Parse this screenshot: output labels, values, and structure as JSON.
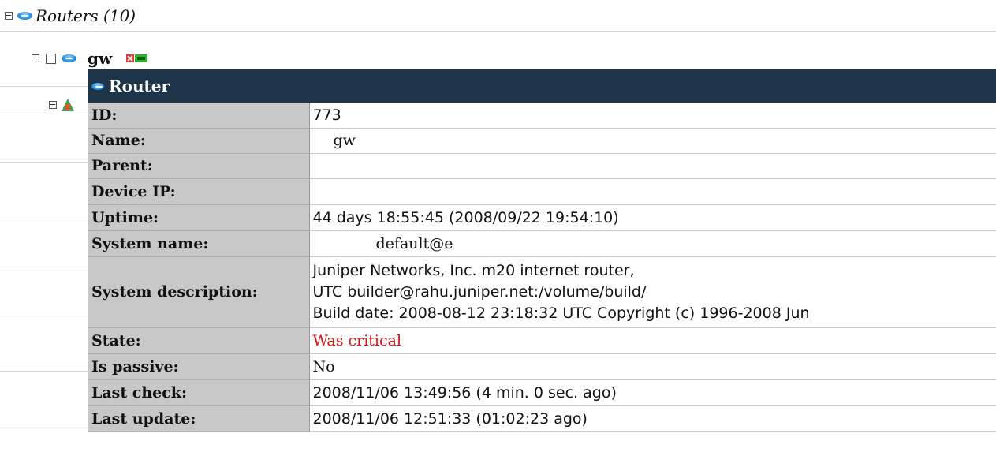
{
  "tree": {
    "root_label": "Routers (10)",
    "node_label": "gw"
  },
  "popup": {
    "title": "Router",
    "rows": [
      {
        "key": "ID:",
        "value": "773"
      },
      {
        "key": "Name:",
        "value": "gw"
      },
      {
        "key": "Parent:",
        "value": ""
      },
      {
        "key": "Device IP:",
        "value": ""
      },
      {
        "key": "Uptime:",
        "value": "44 days 18:55:45 (2008/09/22 19:54:10)"
      },
      {
        "key": "System name:",
        "value": "default@e"
      },
      {
        "key": "System description:",
        "lines": [
          "Juniper Networks, Inc. m20 internet router,",
          "UTC builder@rahu.juniper.net:/volume/build/",
          "Build date: 2008-08-12 23:18:32 UTC Copyright (c) 1996-2008 Jun"
        ]
      },
      {
        "key": "State:",
        "value": "Was critical"
      },
      {
        "key": "Is passive:",
        "value": "No"
      },
      {
        "key": "Last check:",
        "value": "2008/11/06 13:49:56 (4 min. 0 sec. ago)"
      },
      {
        "key": "Last update:",
        "value": "2008/11/06 12:51:33 (01:02:23 ago)"
      }
    ]
  },
  "colors": {
    "header_bg": "#1e3448",
    "key_bg": "#c8c8c8",
    "state_critical": "#e11010"
  }
}
